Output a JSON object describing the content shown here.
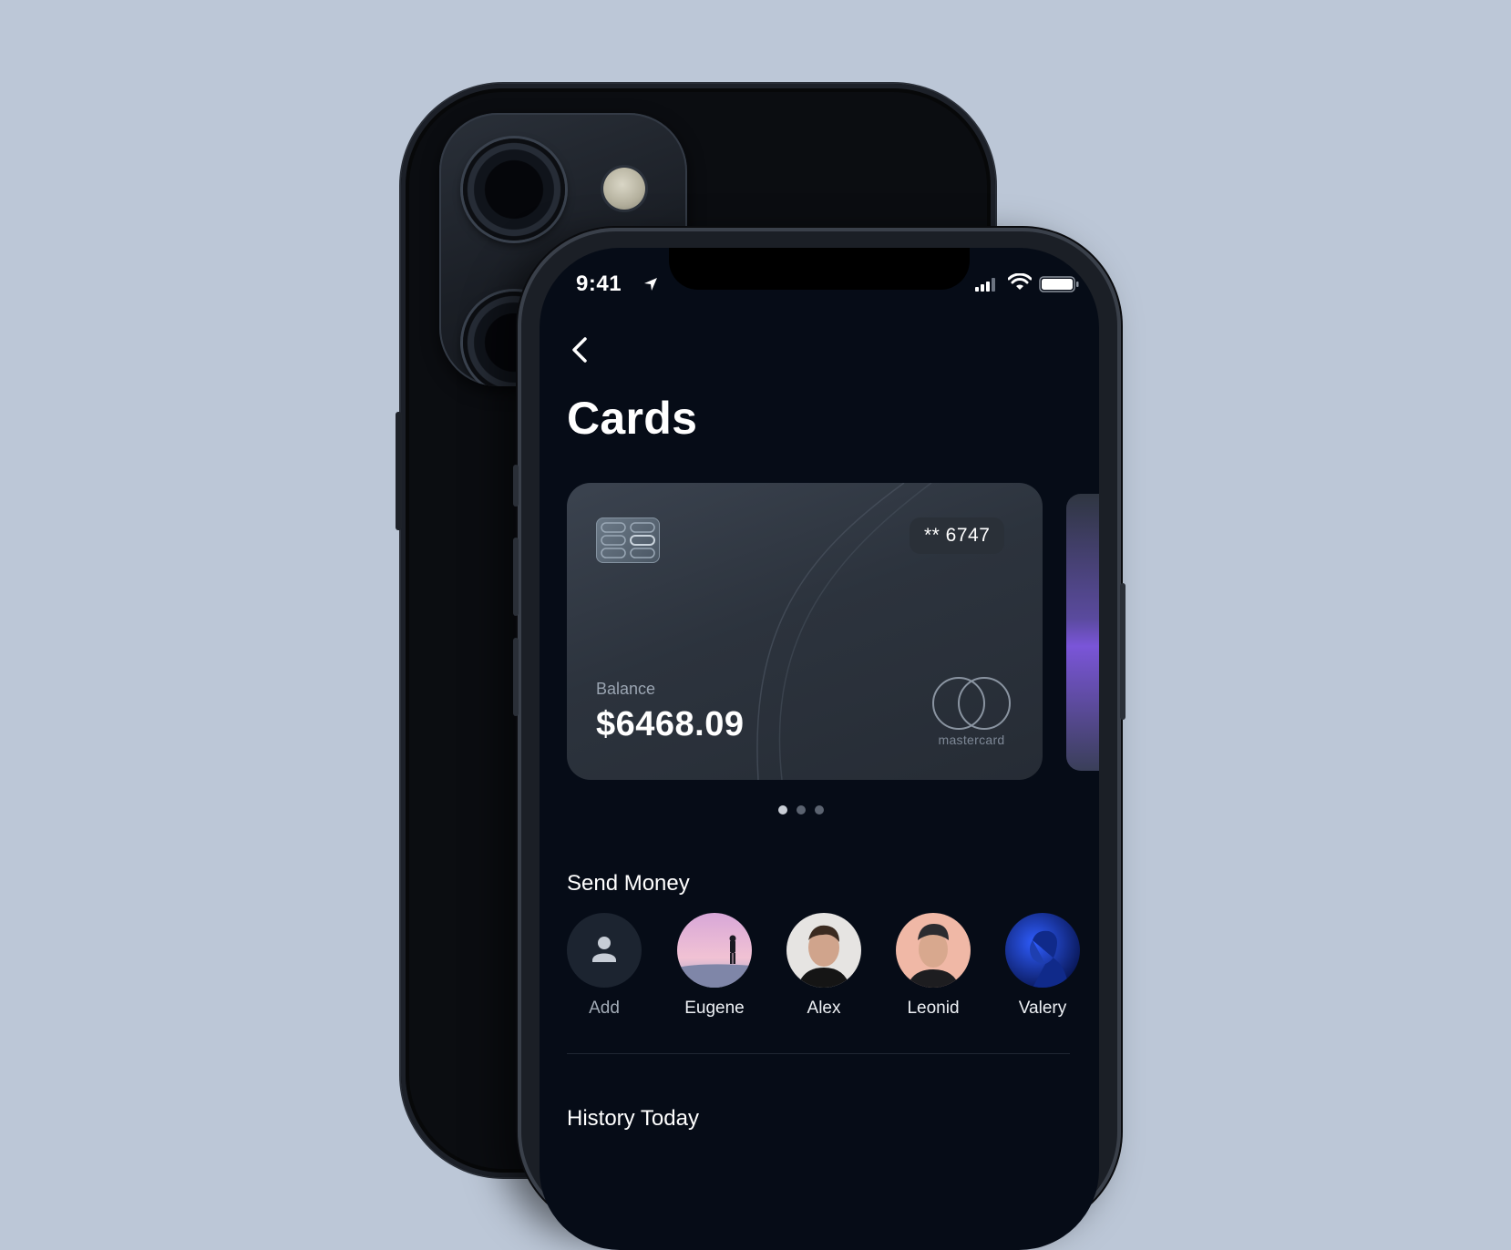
{
  "status_bar": {
    "time": "9:41"
  },
  "header": {
    "title": "Cards"
  },
  "card": {
    "number_masked": "** 6747",
    "balance_label": "Balance",
    "balance_amount": "$6468.09",
    "brand": "mastercard"
  },
  "pagination": {
    "count": 3,
    "active_index": 0
  },
  "send_money": {
    "title": "Send Money",
    "add_label": "Add",
    "contacts": [
      {
        "name": "Eugene"
      },
      {
        "name": "Alex"
      },
      {
        "name": "Leonid"
      },
      {
        "name": "Valery"
      }
    ]
  },
  "history": {
    "title": "History Today"
  },
  "colors": {
    "background": "#bcc7d7",
    "screen": "#060c17",
    "card": "#2f363f",
    "accent_purple": "#7a55d8"
  }
}
